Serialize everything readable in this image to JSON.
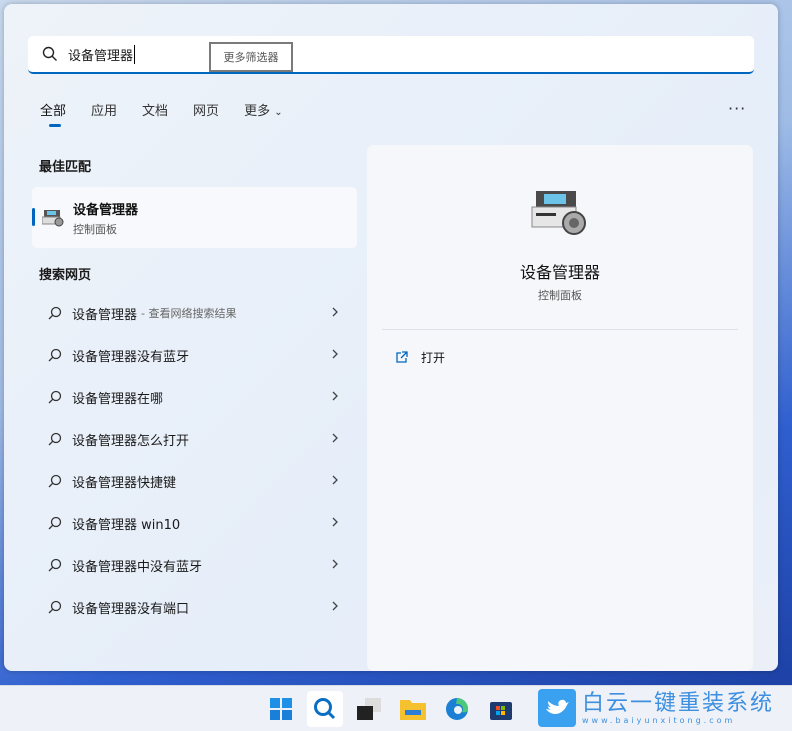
{
  "search": {
    "query": "设备管理器",
    "filter_button": "更多筛选器"
  },
  "tabs": [
    {
      "label": "全部",
      "active": true
    },
    {
      "label": "应用"
    },
    {
      "label": "文档"
    },
    {
      "label": "网页"
    },
    {
      "label": "更多"
    }
  ],
  "more_options": "···",
  "best_match": {
    "heading": "最佳匹配",
    "title": "设备管理器",
    "subtitle": "控制面板",
    "icon": "device-manager-icon"
  },
  "web": {
    "heading": "搜索网页",
    "items": [
      {
        "label": "设备管理器",
        "sub": "- 查看网络搜索结果"
      },
      {
        "label": "设备管理器没有蓝牙"
      },
      {
        "label": "设备管理器在哪"
      },
      {
        "label": "设备管理器怎么打开"
      },
      {
        "label": "设备管理器快捷键"
      },
      {
        "label": "设备管理器 win10"
      },
      {
        "label": "设备管理器中没有蓝牙"
      },
      {
        "label": "设备管理器没有端口"
      }
    ]
  },
  "detail": {
    "title": "设备管理器",
    "subtitle": "控制面板",
    "actions": [
      {
        "label": "打开",
        "icon": "open-external-icon"
      }
    ]
  },
  "taskbar": {
    "items": [
      "start",
      "search",
      "task-view",
      "file-explorer",
      "edge",
      "store"
    ]
  },
  "watermark": {
    "title": "白云一键重装系统",
    "url": "www.baiyunxitong.com"
  },
  "colors": {
    "accent": "#0067c0"
  }
}
